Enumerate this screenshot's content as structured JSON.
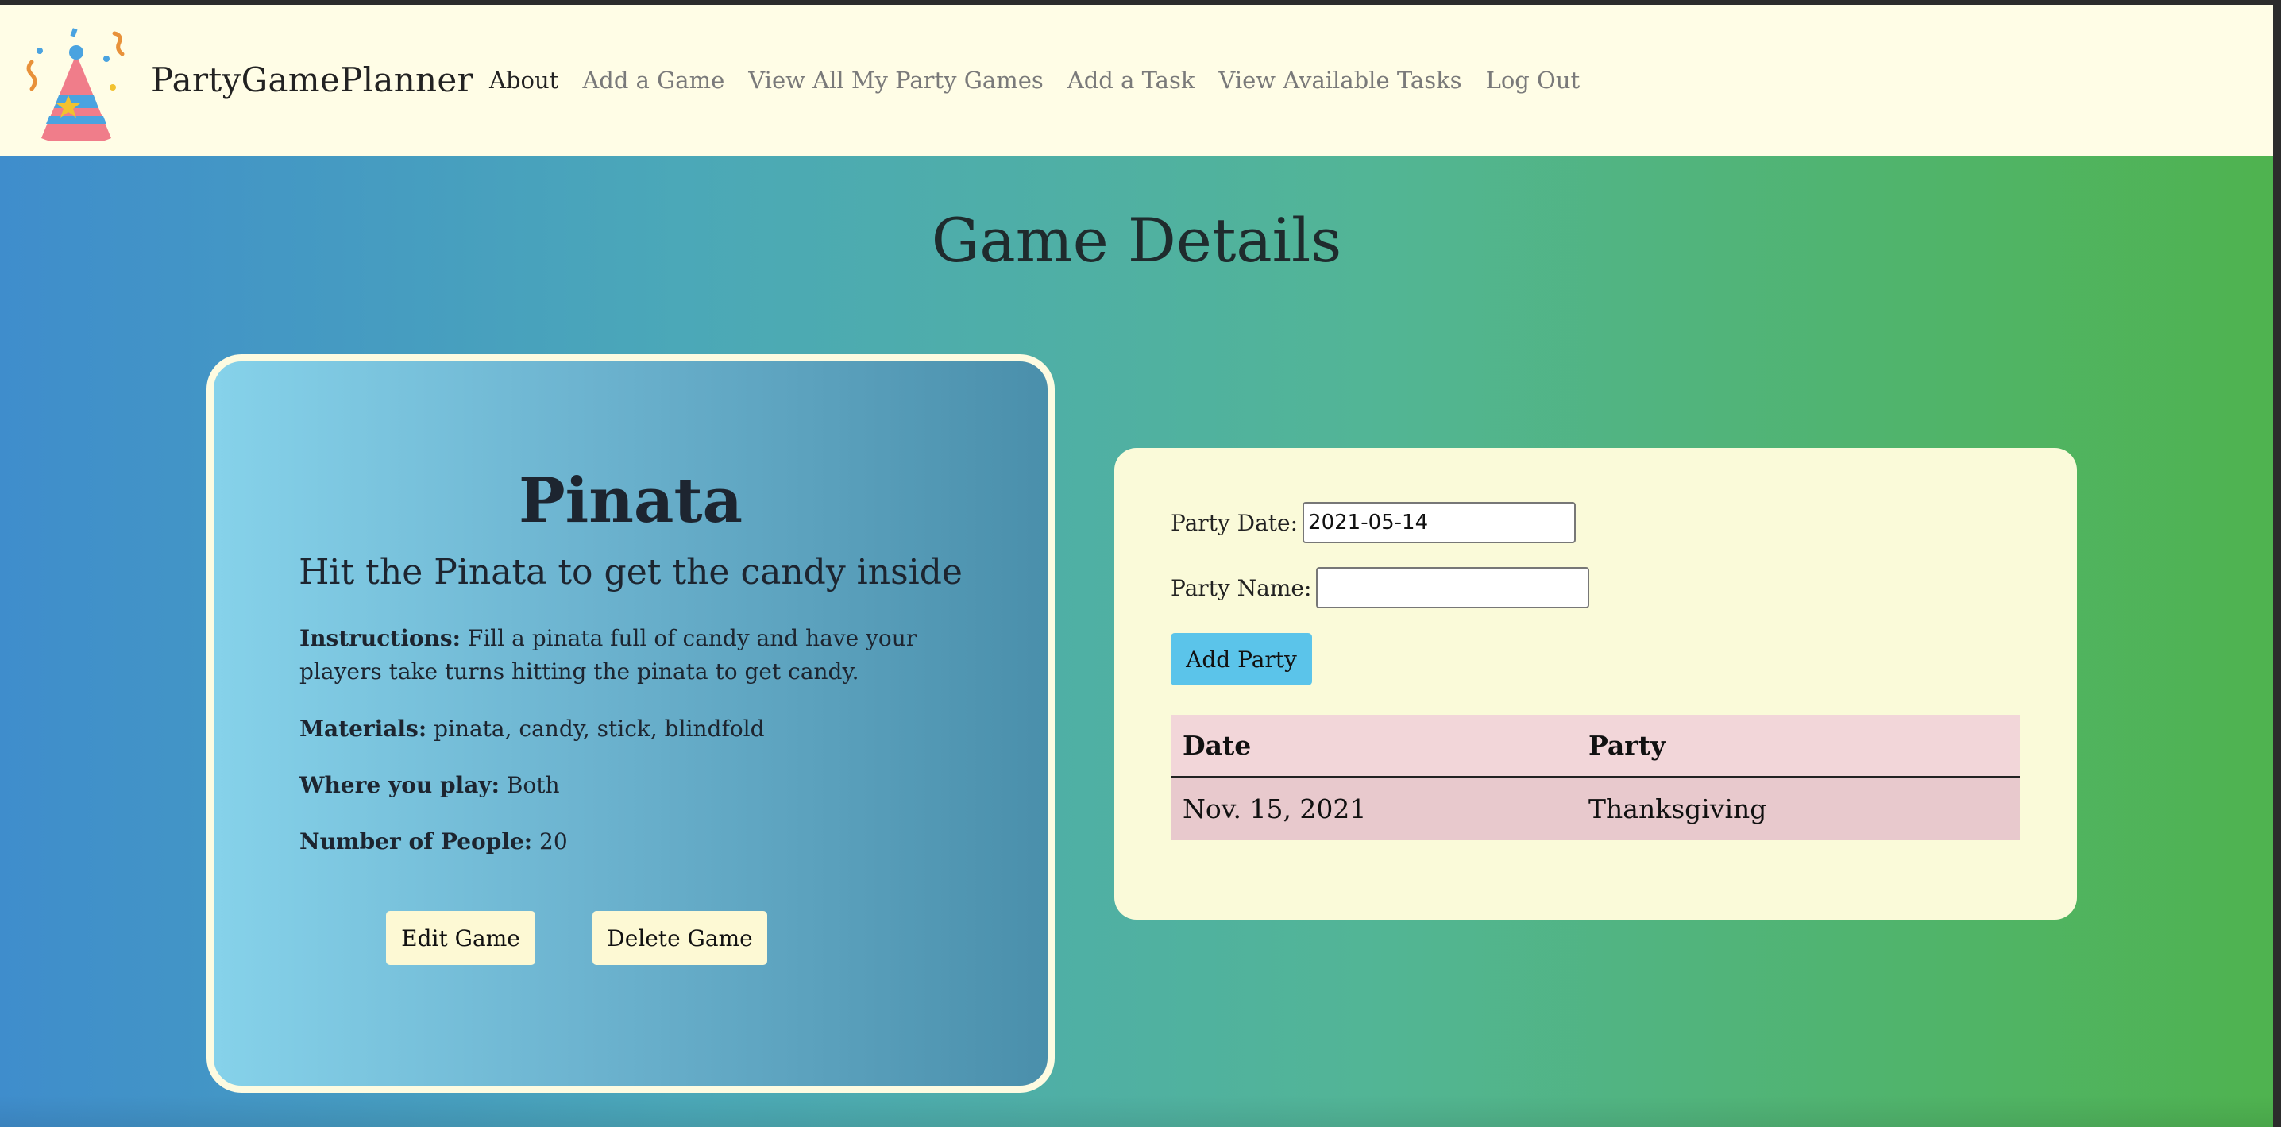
{
  "nav": {
    "brand": "PartyGamePlanner",
    "links": [
      {
        "label": "About",
        "active": true
      },
      {
        "label": "Add a Game",
        "active": false
      },
      {
        "label": "View All My Party Games",
        "active": false
      },
      {
        "label": "Add a Task",
        "active": false
      },
      {
        "label": "View Available Tasks",
        "active": false
      },
      {
        "label": "Log Out",
        "active": false
      }
    ]
  },
  "page": {
    "title": "Game Details"
  },
  "game": {
    "name": "Pinata",
    "tagline": "Hit the Pinata to get the candy inside",
    "instructions_label": "Instructions:",
    "instructions": "Fill a pinata full of candy and have your players take turns hitting the pinata to get candy.",
    "materials_label": "Materials:",
    "materials": "pinata, candy, stick, blindfold",
    "where_label": "Where you play:",
    "where": "Both",
    "people_label": "Number of People:",
    "people": "20",
    "edit_label": "Edit Game",
    "delete_label": "Delete Game"
  },
  "party_form": {
    "date_label": "Party Date:",
    "date_value": "2021-05-14",
    "name_label": "Party Name:",
    "name_value": "",
    "submit_label": "Add Party"
  },
  "party_table": {
    "headers": [
      "Date",
      "Party"
    ],
    "rows": [
      [
        "Nov. 15, 2021",
        "Thanksgiving"
      ]
    ]
  },
  "colors": {
    "navbar_bg": "#fffde6",
    "card_border": "#fdfbe1",
    "panel_bg": "#fafad9",
    "add_party_button": "#5bc4ea",
    "table_header_bg": "#f2d6d9",
    "table_row_bg": "#e8c9cd"
  },
  "icons": {
    "logo": "party-hat-icon"
  }
}
